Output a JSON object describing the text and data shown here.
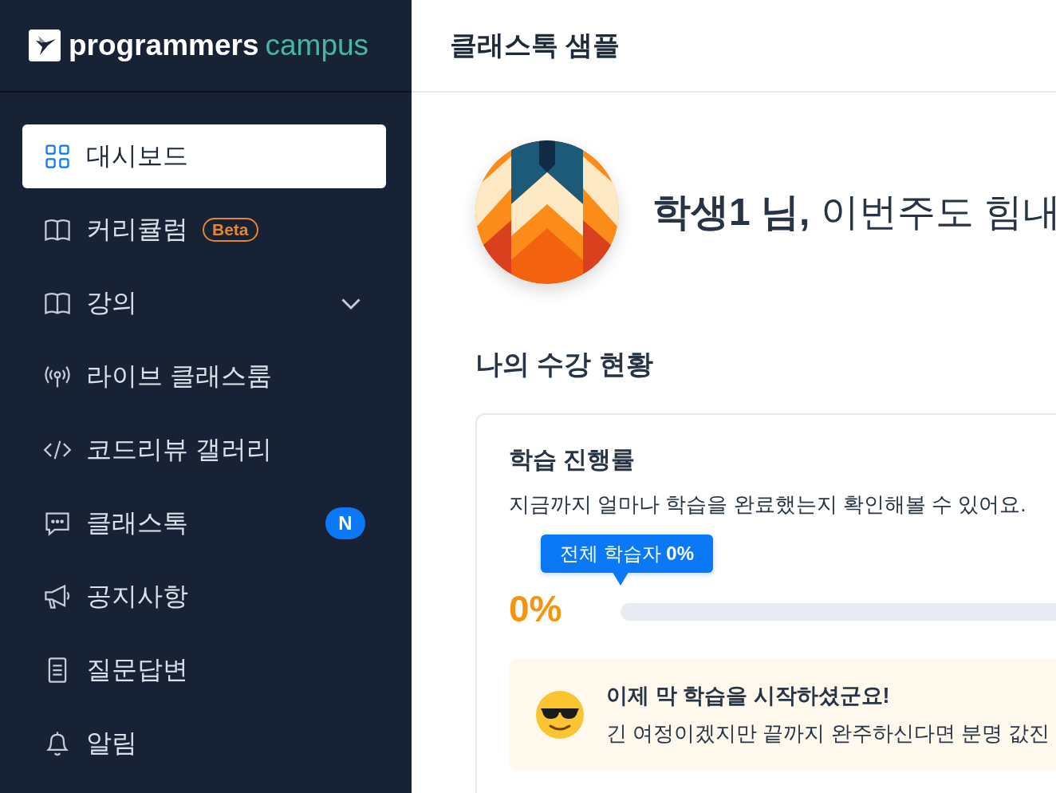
{
  "sidebar": {
    "logo": {
      "word": "programmers",
      "suffix": "campus"
    },
    "items": [
      {
        "kind": "dashboard",
        "label": "대시보드",
        "selected": true
      },
      {
        "kind": "curriculum",
        "label": "커리큘럼",
        "selected": false,
        "badge": "Beta"
      },
      {
        "kind": "lecture",
        "label": "강의",
        "selected": false,
        "expanded": false
      },
      {
        "kind": "live",
        "label": "라이브 클래스룸",
        "selected": false
      },
      {
        "kind": "code",
        "label": "코드리뷰 갤러리",
        "selected": false
      },
      {
        "kind": "chat",
        "label": "클래스톡",
        "selected": false,
        "new_badge": "N"
      },
      {
        "kind": "notice",
        "label": "공지사항",
        "selected": false
      },
      {
        "kind": "qna",
        "label": "질문답변",
        "selected": false
      },
      {
        "kind": "alarm",
        "label": "알림",
        "selected": false
      }
    ]
  },
  "header": {
    "title": "클래스톡 샘플"
  },
  "greeting": "**학생1 님,** 이번주도 힘내",
  "section_title": "나의 수강 현황",
  "progress_card": {
    "title": "학습 진행률",
    "description": "지금까지 얼마나 학습을 완료했는지 확인해볼 수 있어요.",
    "tooltip": "전체 학습자 **0%**",
    "value": "0%",
    "level": 0,
    "notice": {
      "title": "이제 막 학습을 시작하셨군요!",
      "text": "긴 여정이겠지만 끝까지 완주하신다면 분명 값진"
    }
  }
}
